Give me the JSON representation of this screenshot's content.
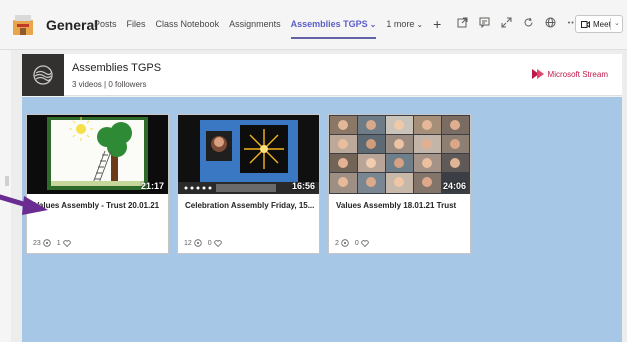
{
  "header": {
    "channel_name": "General",
    "tabs": [
      {
        "label": "Posts"
      },
      {
        "label": "Files"
      },
      {
        "label": "Class Notebook"
      },
      {
        "label": "Assignments"
      },
      {
        "label": "Assemblies TGPS",
        "active": true
      },
      {
        "label": "1 more"
      }
    ],
    "meet_label": "Meet"
  },
  "channel": {
    "title": "Assemblies TGPS",
    "subtitle": "3 videos | 0 followers",
    "brand": "Microsoft Stream",
    "brand_color": "#bc1948"
  },
  "videos": [
    {
      "title": "Values Assembly - Trust 20.01.21",
      "duration": "21:17",
      "views": "23",
      "likes": "1"
    },
    {
      "title": "Celebration Assembly Friday, 15...",
      "duration": "16:56",
      "views": "12",
      "likes": "0"
    },
    {
      "title": "Values Assembly 18.01.21 Trust",
      "duration": "24:06",
      "views": "2",
      "likes": "0"
    }
  ],
  "colors": {
    "accent": "#6264a7",
    "video_area_bg": "#a7c7e7",
    "annotation_arrow": "#6a2c91"
  }
}
